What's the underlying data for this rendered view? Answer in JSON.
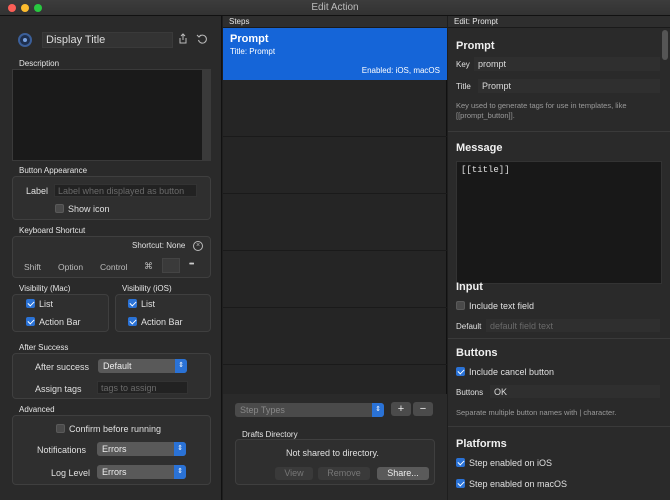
{
  "window": {
    "title": "Edit Action"
  },
  "left": {
    "display_title": "Display Title",
    "description_label": "Description",
    "button_appearance": {
      "heading": "Button Appearance",
      "label_label": "Label",
      "label_placeholder": "Label when displayed as button",
      "show_icon": "Show icon"
    },
    "keyboard": {
      "heading": "Keyboard Shortcut",
      "shortcut": "Shortcut: None",
      "shift": "Shift",
      "option": "Option",
      "control": "Control",
      "cmd": "⌘",
      "more": "•••"
    },
    "visibility_mac": {
      "heading": "Visibility (Mac)",
      "list": "List",
      "action_bar": "Action Bar"
    },
    "visibility_ios": {
      "heading": "Visibility (iOS)",
      "list": "List",
      "action_bar": "Action Bar"
    },
    "after_success": {
      "heading": "After Success",
      "after_label": "After success",
      "after_value": "Default",
      "tags_label": "Assign tags",
      "tags_placeholder": "tags to assign"
    },
    "advanced": {
      "heading": "Advanced",
      "confirm": "Confirm before running",
      "notifications_label": "Notifications",
      "notifications_value": "Errors",
      "log_label": "Log Level",
      "log_value": "Errors"
    }
  },
  "middle": {
    "heading": "Steps",
    "step": {
      "title": "Prompt",
      "subtitle": "Title: Prompt",
      "enabled": "Enabled: iOS, macOS"
    },
    "step_types": "Step Types",
    "plus": "+",
    "minus": "−",
    "drafts": {
      "heading": "Drafts Directory",
      "status": "Not shared to directory.",
      "view": "View",
      "remove": "Remove",
      "share": "Share..."
    }
  },
  "right": {
    "heading": "Edit: Prompt",
    "prompt_heading": "Prompt",
    "key_label": "Key",
    "key_value": "prompt",
    "title_label": "Title",
    "title_value": "Prompt",
    "key_help": "Key used to generate tags for use in templates, like [[prompt_button]].",
    "message_heading": "Message",
    "message_value": "[[title]]",
    "input_heading": "Input",
    "include_text": "Include text field",
    "default_label": "Default",
    "default_placeholder": "default field text",
    "buttons_heading": "Buttons",
    "include_cancel": "Include cancel button",
    "buttons_label": "Buttons",
    "buttons_value": "OK",
    "buttons_help": "Separate multiple button names with | character.",
    "platforms_heading": "Platforms",
    "ios": "Step enabled on iOS",
    "macos": "Step enabled on macOS"
  }
}
